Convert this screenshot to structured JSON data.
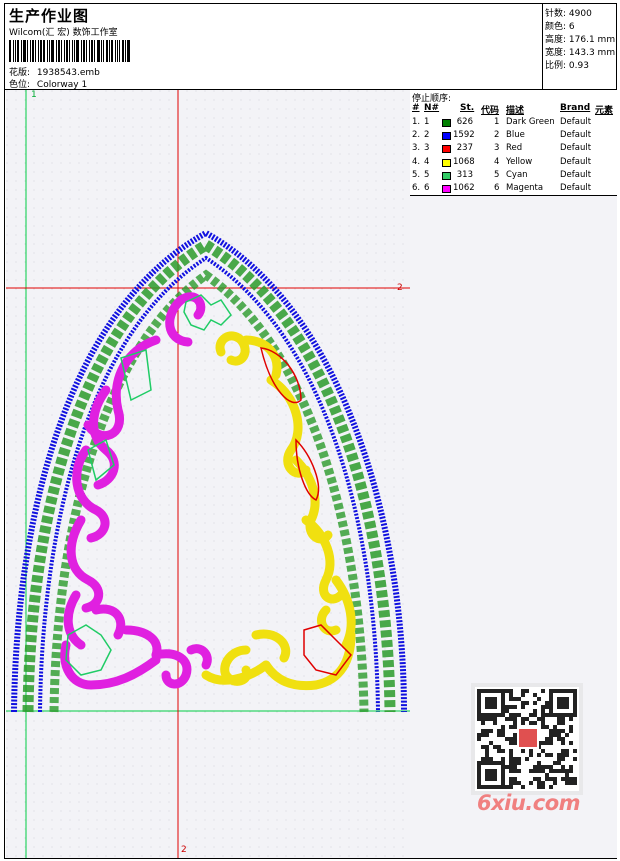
{
  "header": {
    "title": "生产作业图",
    "company": "Wilcom(汇 宏) 数饰工作室",
    "pattern_label": "花版:",
    "pattern_value": "1938543.emb",
    "colorway_label": "色位:",
    "colorway_value": "Colorway 1"
  },
  "stats": {
    "stitches_label": "针数:",
    "stitches_value": "4900",
    "colors_label": "颜色:",
    "colors_value": "6",
    "height_label": "高度:",
    "height_value": "176.1 mm",
    "width_label": "宽度:",
    "width_value": "143.3 mm",
    "scale_label": "比例:",
    "scale_value": "0.93"
  },
  "stop_sequence": {
    "title": "停止顺序:",
    "headers": {
      "num": "#",
      "no": "N#",
      "st": "St.",
      "code": "代码",
      "desc": "描述",
      "brand": "Brand",
      "element": "元素"
    },
    "rows": [
      {
        "num": "1.",
        "no": "1",
        "color": "#008000",
        "st": "626",
        "code": "1",
        "desc": "Dark Green",
        "brand": "Default"
      },
      {
        "num": "2.",
        "no": "2",
        "color": "#0000ff",
        "st": "1592",
        "code": "2",
        "desc": "Blue",
        "brand": "Default"
      },
      {
        "num": "3.",
        "no": "3",
        "color": "#ff0000",
        "st": "237",
        "code": "3",
        "desc": "Red",
        "brand": "Default"
      },
      {
        "num": "4.",
        "no": "4",
        "color": "#ffff00",
        "st": "1068",
        "code": "4",
        "desc": "Yellow",
        "brand": "Default"
      },
      {
        "num": "5.",
        "no": "5",
        "color": "#33cc66",
        "st": "313",
        "code": "5",
        "desc": "Cyan",
        "brand": "Default"
      },
      {
        "num": "6.",
        "no": "6",
        "color": "#ff00ff",
        "st": "1062",
        "code": "6",
        "desc": "Magenta",
        "brand": "Default"
      }
    ]
  },
  "rulers": {
    "top_left": "1",
    "right_mark": "2",
    "bottom_mark": "2"
  },
  "watermark": {
    "brand": "6xiu.com"
  },
  "colors": {
    "guide_green": "#00cc44",
    "guide_red": "#e00000",
    "grid_bg": "#f3f3f7"
  }
}
